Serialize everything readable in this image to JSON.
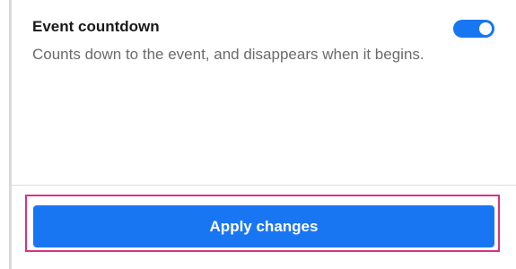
{
  "setting": {
    "title": "Event countdown",
    "description": "Counts down to the event, and disappears when it begins.",
    "enabled": true
  },
  "footer": {
    "apply_label": "Apply changes"
  },
  "colors": {
    "accent": "#1976f2",
    "highlight": "#d63384"
  }
}
